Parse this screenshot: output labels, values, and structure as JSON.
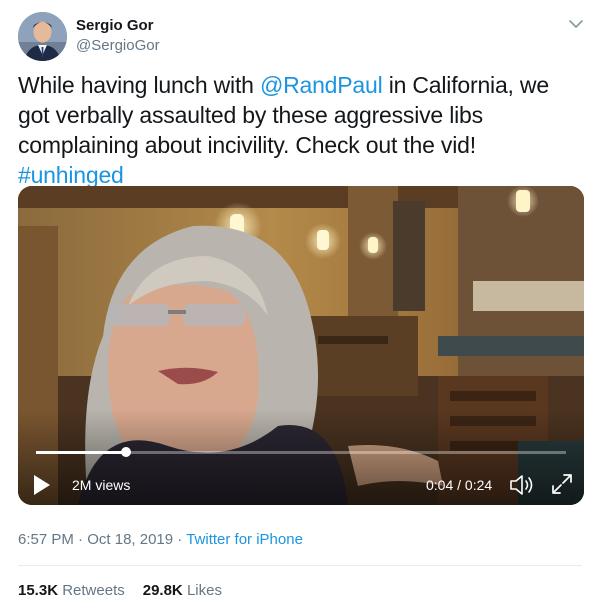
{
  "author": {
    "display_name": "Sergio Gor",
    "handle": "@SergioGor"
  },
  "tweet": {
    "text_parts": [
      "While having lunch with ",
      "@RandPaul",
      " in California, we got verbally assaulted by these aggressive libs complaining about incivility. Check out the vid! ",
      "#unhinged"
    ],
    "time": "6:57 PM",
    "separator": " · ",
    "date": "Oct 18, 2019",
    "source": "Twitter for iPhone"
  },
  "video": {
    "views": "2M views",
    "time": "0:04 / 0:24",
    "progress": 0.17
  },
  "stats": {
    "retweets_count": "15.3K",
    "retweets_label": "Retweets",
    "likes_count": "29.8K",
    "likes_label": "Likes"
  },
  "colors": {
    "link": "#1b95e0",
    "text": "#14171a",
    "muted": "#657786"
  },
  "icons": [
    "chevron-down-icon",
    "play-icon",
    "volume-icon",
    "fullscreen-icon"
  ]
}
